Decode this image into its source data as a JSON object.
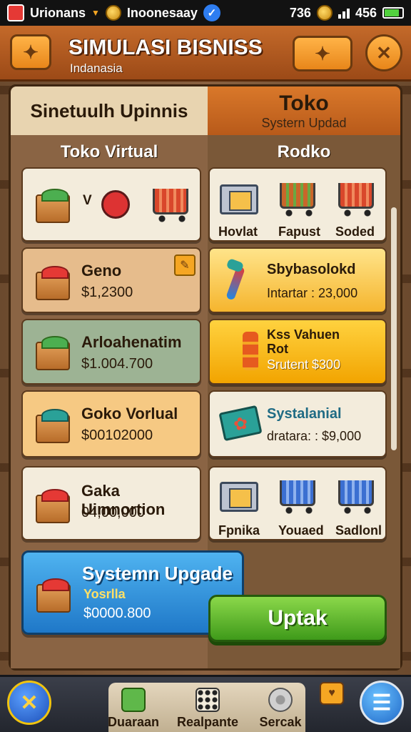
{
  "status_bar": {
    "left_text": "Urionans",
    "mid_text": "Inoonesaay",
    "right_time": "736",
    "right_value": "456"
  },
  "header": {
    "title": "SIMULASI BISNISS",
    "subtitle": "Indanasia",
    "left_button_icon": "puzzle-icon",
    "mid_button_icon": "puzzle-icon",
    "close_icon": "close-icon"
  },
  "tabs": {
    "left": {
      "label": "Sinetuulh Upinnis"
    },
    "right": {
      "label": "Toko",
      "sublabel": "Systern Updad"
    }
  },
  "columns": {
    "left_header": "Toko Virtual",
    "right_header": "Rodko"
  },
  "left_cards": [
    {
      "label": "V",
      "icons": [
        "box-icon",
        "robot-icon",
        "cart-icon"
      ]
    },
    {
      "name": "Geno",
      "price": "$1,2300",
      "badge_icon": "tag-icon"
    },
    {
      "name": "Arloahenatim",
      "price": "$1.004.700"
    },
    {
      "name": "Goko Vorlual",
      "price": "$00102000"
    },
    {
      "name": "Gaka Uimnortion",
      "price": "04,00,000"
    }
  ],
  "right_cards": [
    {
      "labels": [
        "Hovlat",
        "Fapust",
        "Soded"
      ],
      "icons": [
        "crate-icon",
        "cart-icon",
        "cart-icon"
      ]
    },
    {
      "name": "Sbybasolokd",
      "price": "Intartar : 23,000",
      "icon": "tool-icon"
    },
    {
      "name_line1": "Kss Vahuen",
      "name_line2": "Rot",
      "price": "Srutent $300",
      "icon": "stack-icon"
    },
    {
      "name": "Systalanial",
      "price": "dratara: : $9,000",
      "icon": "plate-icon"
    },
    {
      "labels": [
        "Fpnika",
        "Youaed",
        "Sadlonl"
      ],
      "icons": [
        "crate-icon",
        "cart-icon",
        "cart-icon"
      ]
    }
  ],
  "upgrade": {
    "title": "Systemn Upgade",
    "subtitle": "Yosrlla",
    "price": "$0000.800",
    "button_label": "Uptak"
  },
  "bottom_nav": {
    "items": [
      {
        "label": "Duaraan",
        "icon": "cube-icon"
      },
      {
        "label": "Realpante",
        "icon": "grid-icon"
      },
      {
        "label": "Sercak",
        "icon": "disk-icon"
      }
    ],
    "left_round_icon": "close-icon",
    "right_round_icon": "menu-icon",
    "mini_icon": "heart-icon"
  },
  "colors": {
    "header": "#c46a2a",
    "upgrade_blue": "#1f78c8",
    "button_green": "#3f9a1a",
    "gold_card": "#f2a400"
  }
}
